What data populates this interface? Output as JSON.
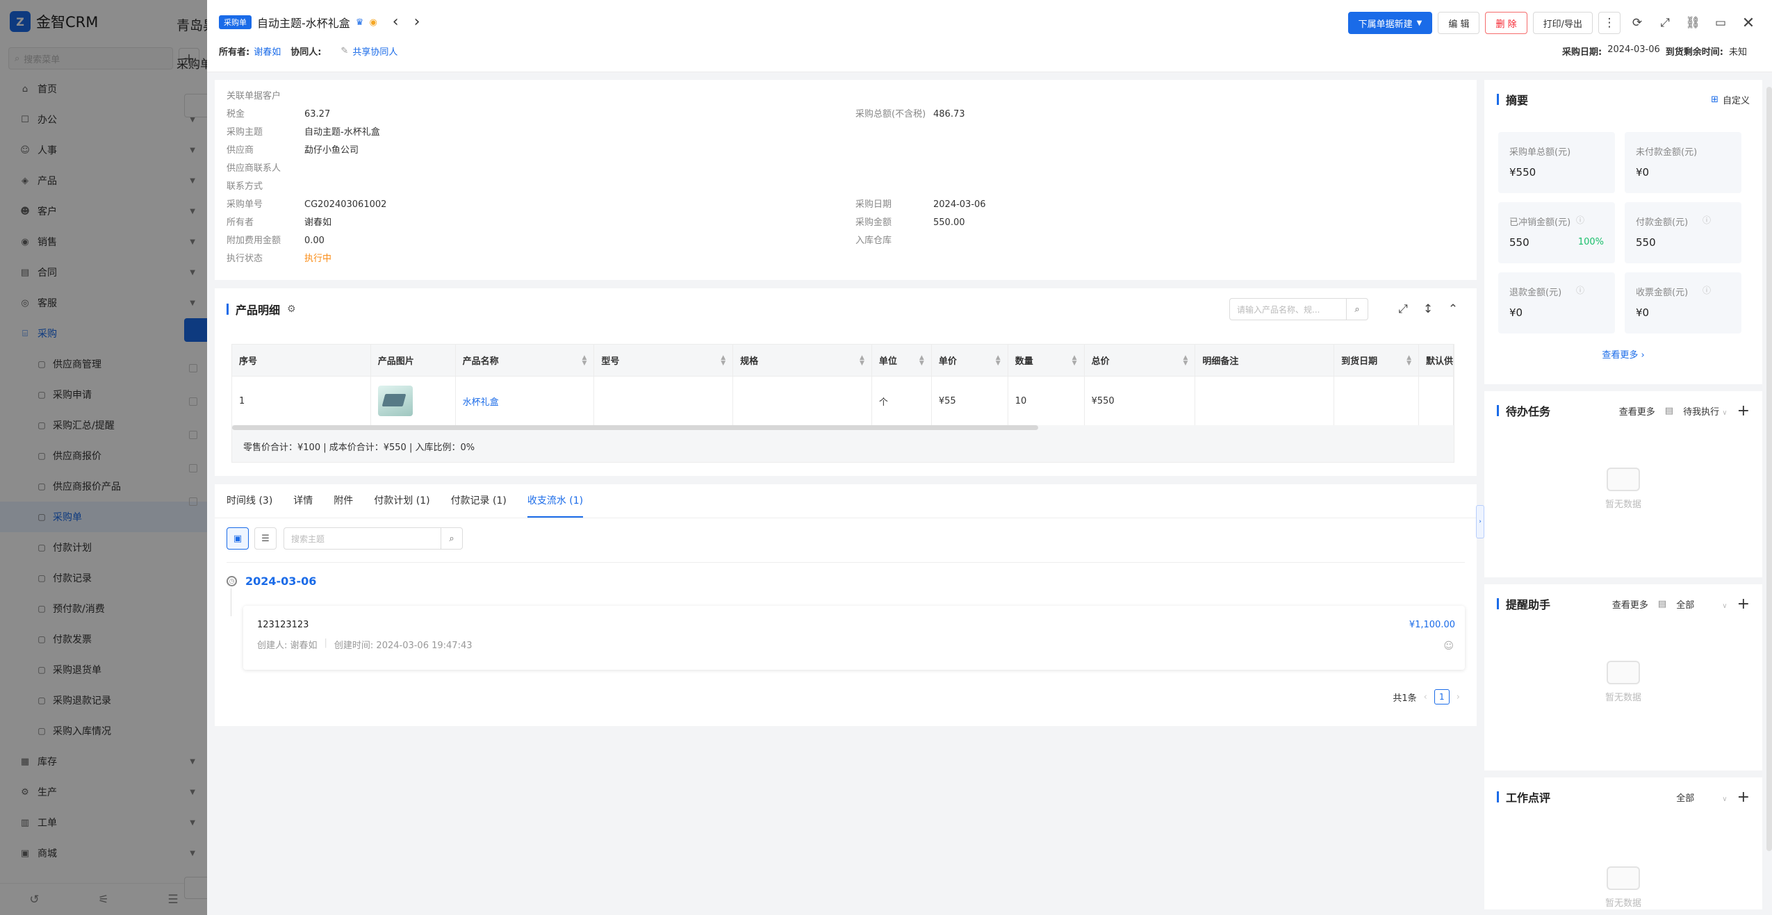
{
  "sidebar": {
    "brand": "金智CRM",
    "search_placeholder": "搜索菜单",
    "items": [
      {
        "label": "首页",
        "icon": "home-icon",
        "glyph": "⌂"
      },
      {
        "label": "办公",
        "icon": "office-icon",
        "glyph": "☐"
      },
      {
        "label": "人事",
        "icon": "people-icon",
        "glyph": "☺"
      },
      {
        "label": "产品",
        "icon": "product-icon",
        "glyph": "◈"
      },
      {
        "label": "客户",
        "icon": "customer-icon",
        "glyph": "☻"
      },
      {
        "label": "销售",
        "icon": "sales-icon",
        "glyph": "◉"
      },
      {
        "label": "合同",
        "icon": "contract-icon",
        "glyph": "▤"
      },
      {
        "label": "客服",
        "icon": "service-icon",
        "glyph": "◎"
      },
      {
        "label": "采购",
        "icon": "purchase-icon",
        "glyph": "⌸"
      }
    ],
    "purchase_sub": [
      {
        "label": "供应商管理",
        "icon": "supplier-icon"
      },
      {
        "label": "采购申请",
        "icon": "request-icon"
      },
      {
        "label": "采购汇总/提醒",
        "icon": "summary-icon"
      },
      {
        "label": "供应商报价",
        "icon": "quote-icon"
      },
      {
        "label": "供应商报价产品",
        "icon": "quote-product-icon"
      },
      {
        "label": "采购单",
        "icon": "order-icon"
      },
      {
        "label": "付款计划",
        "icon": "plan-icon"
      },
      {
        "label": "付款记录",
        "icon": "record-icon"
      },
      {
        "label": "预付款/消费",
        "icon": "prepay-icon"
      },
      {
        "label": "付款发票",
        "icon": "invoice-icon"
      },
      {
        "label": "采购退货单",
        "icon": "return-icon"
      },
      {
        "label": "采购退款记录",
        "icon": "refund-icon"
      },
      {
        "label": "采购入库情况",
        "icon": "stockin-icon"
      }
    ],
    "bottom_items": [
      {
        "label": "库存",
        "icon": "stock-icon",
        "glyph": "▦"
      },
      {
        "label": "生产",
        "icon": "production-icon",
        "glyph": "⚙"
      },
      {
        "label": "工单",
        "icon": "ticket-icon",
        "glyph": "▥"
      },
      {
        "label": "商城",
        "icon": "mall-icon",
        "glyph": "▣"
      }
    ]
  },
  "background": {
    "tab": "青岛昇",
    "title": "采购单"
  },
  "header": {
    "type_tag": "采购单",
    "title": "自动主题-水杯礼盒",
    "owner_label": "所有者:",
    "owner": "谢春如",
    "collab_label": "协同人:",
    "share_collab": "共享协同人",
    "buttons": {
      "new_sub": "下属单据新建",
      "edit": "编 辑",
      "delete": "删 除",
      "print": "打印/导出"
    },
    "date_label": "采购日期:",
    "date": "2024-03-06",
    "remain_label": "到货剩余时间:",
    "remain": "未知"
  },
  "info": {
    "left": [
      {
        "label": "关联单据客户",
        "value": ""
      },
      {
        "label": "税金",
        "value": "63.27"
      },
      {
        "label": "采购主题",
        "value": "自动主题-水杯礼盒"
      },
      {
        "label": "供应商",
        "value": "勐仔小鱼公司"
      },
      {
        "label": "供应商联系人",
        "value": ""
      },
      {
        "label": "联系方式",
        "value": ""
      },
      {
        "label": "采购单号",
        "value": "CG202403061002"
      },
      {
        "label": "所有者",
        "value": "谢春如"
      },
      {
        "label": "附加费用金额",
        "value": "0.00"
      },
      {
        "label": "执行状态",
        "value": "执行中"
      }
    ],
    "right": [
      {
        "label": "采购总额(不含税)",
        "value": "486.73"
      },
      {
        "label": "采购日期",
        "value": "2024-03-06"
      },
      {
        "label": "采购金额",
        "value": "550.00"
      },
      {
        "label": "入库仓库",
        "value": ""
      }
    ]
  },
  "products": {
    "title": "产品明细",
    "search_placeholder": "请输入产品名称、规...",
    "columns": [
      "序号",
      "产品图片",
      "产品名称",
      "型号",
      "规格",
      "单位",
      "单价",
      "数量",
      "总价",
      "明细备注",
      "到货日期",
      "默认供应"
    ],
    "rows": [
      {
        "no": "1",
        "name": "水杯礼盒",
        "model": "",
        "spec": "",
        "unit": "个",
        "price": "¥55",
        "qty": "10",
        "total": "¥550",
        "remark": "",
        "arrival": "",
        "supplier": ""
      }
    ],
    "footer": "零售价合计：¥100 |    成本价合计：¥550 |    入库比例：0%"
  },
  "tabs": [
    {
      "label": "时间线 (3)"
    },
    {
      "label": "详情"
    },
    {
      "label": "附件"
    },
    {
      "label": "付款计划 (1)"
    },
    {
      "label": "付款记录 (1)"
    },
    {
      "label": "收支流水 (1)"
    }
  ],
  "flow": {
    "search_placeholder": "搜索主题",
    "date": "2024-03-06",
    "entry": {
      "title": "123123123",
      "creator": "创建人: 谢春如",
      "created": "创建时间: 2024-03-06 19:47:43",
      "amount": "¥1,100.00"
    },
    "pager": {
      "total": "共1条",
      "page": "1"
    }
  },
  "summary": {
    "title": "摘要",
    "custom": "自定义",
    "stats": [
      {
        "label": "采购单总额(元)",
        "value": "¥550"
      },
      {
        "label": "未付款金额(元)",
        "value": "¥0"
      },
      {
        "label": "已冲销金额(元)",
        "value": "550",
        "pct": "100%"
      },
      {
        "label": "付款金额(元)",
        "value": "550"
      },
      {
        "label": "退款金额(元)",
        "value": "¥0"
      },
      {
        "label": "收票金额(元)",
        "value": "¥0"
      }
    ],
    "more": "查看更多"
  },
  "todo": {
    "title": "待办任务",
    "more": "查看更多",
    "filter": "待我执行",
    "empty": "暂无数据"
  },
  "reminder": {
    "title": "提醒助手",
    "more": "查看更多",
    "filter": "全部",
    "empty": "暂无数据"
  },
  "review": {
    "title": "工作点评",
    "filter": "全部",
    "empty": "暂无数据"
  },
  "colors": {
    "primary": "#1a6be8",
    "danger": "#f5222d",
    "success": "#19be6b",
    "warning": "#fa8c16"
  }
}
